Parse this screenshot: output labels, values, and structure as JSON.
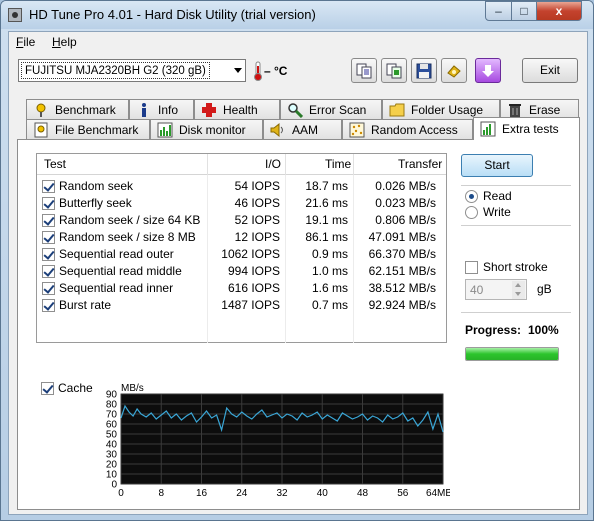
{
  "window": {
    "title": "HD Tune Pro 4.01 - Hard Disk Utility (trial version)",
    "controls": {
      "minimize": "–",
      "maximize": "□",
      "close": "x"
    }
  },
  "menu": {
    "file": {
      "accel": "F",
      "rest": "ile"
    },
    "help": {
      "accel": "H",
      "rest": "elp"
    }
  },
  "toolbar": {
    "drive": "FUJITSU MJA2320BH G2 (320 gB)",
    "temperature": "– °C",
    "buttons": [
      "copy-text-icon",
      "copy-screenshot-icon",
      "save-icon",
      "options-icon",
      "download-icon"
    ],
    "exit_label": "Exit"
  },
  "tabs": {
    "row1": [
      "Benchmark",
      "Info",
      "Health",
      "Error Scan",
      "Folder Usage",
      "Erase"
    ],
    "row2": [
      "File Benchmark",
      "Disk monitor",
      "AAM",
      "Random Access",
      "Extra tests"
    ],
    "active": "Extra tests"
  },
  "results": {
    "columns": [
      "Test",
      "I/O",
      "Time",
      "Transfer"
    ],
    "rows": [
      {
        "test": "Random seek",
        "io": "54 IOPS",
        "time": "18.7 ms",
        "transfer": "0.026 MB/s",
        "checked": true
      },
      {
        "test": "Butterfly seek",
        "io": "46 IOPS",
        "time": "21.6 ms",
        "transfer": "0.023 MB/s",
        "checked": true
      },
      {
        "test": "Random seek / size 64 KB",
        "io": "52 IOPS",
        "time": "19.1 ms",
        "transfer": "0.806 MB/s",
        "checked": true
      },
      {
        "test": "Random seek / size 8 MB",
        "io": "12 IOPS",
        "time": "86.1 ms",
        "transfer": "47.091 MB/s",
        "checked": true
      },
      {
        "test": "Sequential read outer",
        "io": "1062 IOPS",
        "time": "0.9 ms",
        "transfer": "66.370 MB/s",
        "checked": true
      },
      {
        "test": "Sequential read middle",
        "io": "994 IOPS",
        "time": "1.0 ms",
        "transfer": "62.151 MB/s",
        "checked": true
      },
      {
        "test": "Sequential read inner",
        "io": "616 IOPS",
        "time": "1.6 ms",
        "transfer": "38.512 MB/s",
        "checked": true
      },
      {
        "test": "Burst rate",
        "io": "1487 IOPS",
        "time": "0.7 ms",
        "transfer": "92.924 MB/s",
        "checked": true
      }
    ]
  },
  "controls": {
    "start_label": "Start",
    "read_label": "Read",
    "write_label": "Write",
    "mode": "read",
    "short_stroke_label": "Short stroke",
    "short_stroke_checked": false,
    "short_stroke_value": "40",
    "short_stroke_unit": "gB",
    "progress_label": "Progress:",
    "progress_value": "100%",
    "progress_fraction": 1.0,
    "cache_label": "Cache",
    "cache_checked": true
  },
  "chart_data": {
    "type": "line",
    "ylabel": "MB/s",
    "xlabel": "",
    "ylim": [
      0,
      90
    ],
    "xlim": [
      0,
      64
    ],
    "y_ticks": [
      "0",
      "10",
      "20",
      "30",
      "40",
      "50",
      "60",
      "70",
      "80",
      "90"
    ],
    "x_ticks": [
      "0",
      "8",
      "16",
      "24",
      "32",
      "40",
      "48",
      "56",
      "64MB"
    ],
    "grid": true,
    "background": "#0d0d0d",
    "line_color": "#3aa6d6",
    "series": [
      {
        "x": [
          0,
          0.8,
          1.6,
          2.4,
          3.2,
          4,
          5,
          6,
          7,
          8,
          9,
          10,
          11,
          12,
          13,
          14,
          15,
          16,
          17,
          18,
          19,
          20,
          21,
          22,
          23,
          24,
          25,
          26,
          27,
          28,
          29,
          30,
          31,
          32,
          33,
          34,
          35,
          36,
          37,
          38,
          39,
          40,
          41,
          42,
          43,
          44,
          45,
          46,
          47,
          48,
          49,
          50,
          51,
          52,
          53,
          54,
          55,
          56,
          57,
          58,
          59,
          60,
          61,
          62,
          63,
          64
        ],
        "y": [
          66,
          78,
          72,
          68,
          75,
          70,
          67,
          71,
          65,
          69,
          73,
          66,
          70,
          64,
          68,
          71,
          62,
          67,
          73,
          66,
          69,
          54,
          76,
          70,
          67,
          72,
          68,
          65,
          70,
          74,
          67,
          69,
          71,
          66,
          70,
          68,
          64,
          71,
          67,
          69,
          72,
          65,
          69,
          66,
          63,
          71,
          68,
          65,
          67,
          70,
          64,
          68,
          66,
          62,
          69,
          65,
          67,
          71,
          63,
          66,
          58,
          64,
          72,
          55,
          70,
          52
        ]
      }
    ]
  }
}
